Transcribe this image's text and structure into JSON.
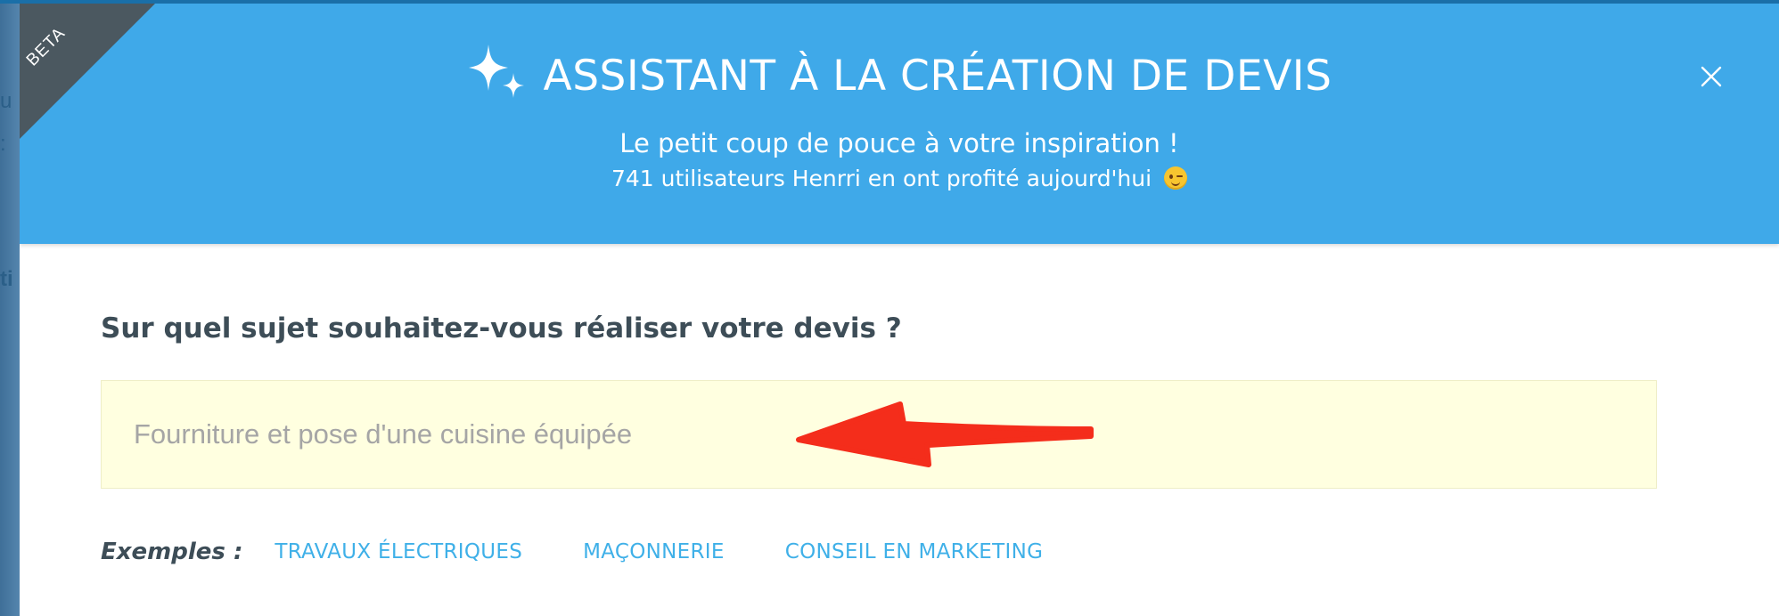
{
  "modal": {
    "badge": "BETA",
    "title": "ASSISTANT À LA CRÉATION DE DEVIS",
    "subtitle": "Le petit coup de pouce à votre inspiration !",
    "stats": {
      "count": "741",
      "text": "utilisateurs Henrri en ont profité aujourd'hui",
      "emoji": "wink-emoji"
    },
    "close_icon": "close-icon"
  },
  "form": {
    "question": "Sur quel sujet souhaitez-vous réaliser votre devis ?",
    "subject_input": {
      "value": "",
      "placeholder": "Fourniture et pose d'une cuisine équipée"
    },
    "examples_label": "Exemples :",
    "examples": [
      "TRAVAUX ÉLECTRIQUES",
      "MAÇONNERIE",
      "CONSEIL EN MARKETING"
    ]
  },
  "background": {
    "fragments": [
      "u",
      ":",
      "ti"
    ]
  },
  "colors": {
    "header_bg": "#3fa9e9",
    "ribbon_bg": "#4b5860",
    "input_bg": "#ffffe0",
    "example_link": "#3fb0e8",
    "heading_text": "#3d4d57",
    "annotation_arrow": "#f42d1b"
  }
}
